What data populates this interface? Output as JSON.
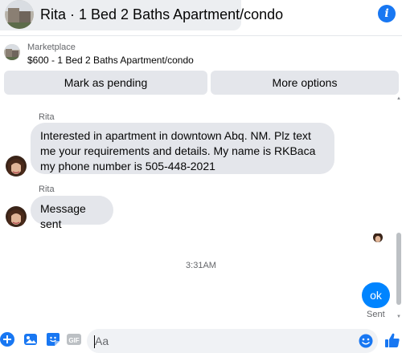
{
  "header": {
    "title": "Rita · 1 Bed 2 Baths Apartment/condo",
    "info_icon": "info-icon"
  },
  "marketplace": {
    "label": "Marketplace",
    "listing": "$600 - 1 Bed 2 Baths Apartment/condo",
    "buttons": {
      "mark_pending": "Mark as pending",
      "more_options": "More options"
    }
  },
  "messages": [
    {
      "sender": "Rita",
      "text": "Interested in apartment in downtown Abq. NM. Plz text me your requirements and details. My name is RKBaca my  phone number is 505-448-2021"
    },
    {
      "sender": "Rita",
      "text": "Message sent"
    }
  ],
  "timestamp": "3:31AM",
  "my_message": {
    "text": "ok",
    "status": "Sent"
  },
  "composer": {
    "placeholder": "Aa",
    "icons": [
      "plus-circle-icon",
      "image-icon",
      "sticker-icon",
      "gif-icon",
      "emoji-icon",
      "thumbs-up-icon"
    ]
  },
  "colors": {
    "accent": "#0084ff",
    "brand_blue": "#1877f2",
    "bubble_gray": "#e4e6eb",
    "secondary_text": "#65676b"
  }
}
